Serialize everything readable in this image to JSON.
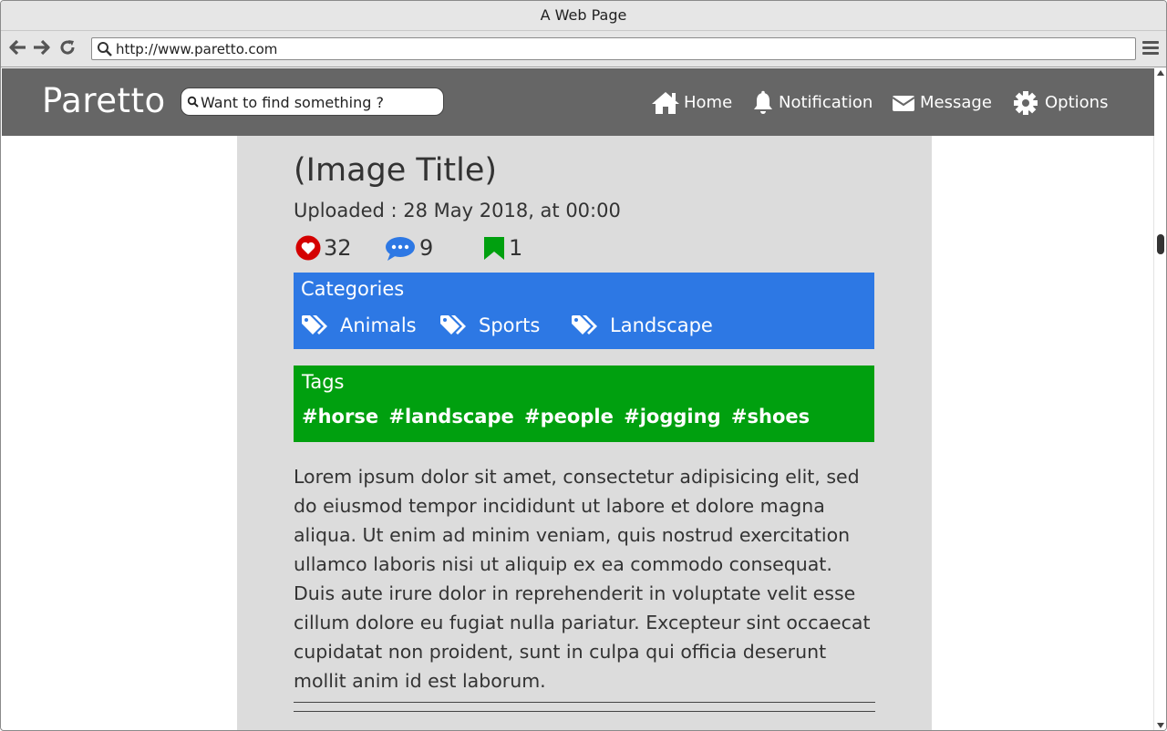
{
  "browser": {
    "window_title": "A Web Page",
    "url": "http://www.paretto.com"
  },
  "site": {
    "logo": "Paretto",
    "search_placeholder": "Want to find something ?",
    "menu": [
      {
        "label": "Home",
        "icon": "home-icon"
      },
      {
        "label": "Notification",
        "icon": "bell-icon"
      },
      {
        "label": "Message",
        "icon": "envelope-icon"
      },
      {
        "label": "Options",
        "icon": "gear-icon"
      }
    ]
  },
  "post": {
    "title": "(Image Title)",
    "uploaded": "Uploaded : 28 May 2018, at 00:00",
    "likes": "32",
    "comments": "9",
    "bookmarks": "1"
  },
  "categories": {
    "label": "Categories",
    "items": [
      "Animals",
      "Sports",
      "Landscape"
    ]
  },
  "tags": {
    "label": "Tags",
    "items": [
      "#horse",
      "#landscape",
      "#people",
      "#jogging",
      "#shoes"
    ]
  },
  "description": "Lorem ipsum dolor sit amet, consectetur adipisicing elit, sed do eiusmod tempor incididunt ut labore et dolore magna aliqua. Ut enim ad minim veniam, quis nostrud exercitation ullamco laboris nisi ut aliquip ex ea commodo consequat. Duis aute irure dolor in reprehenderit in voluptate velit esse cillum dolore eu fugiat nulla pariatur. Excepteur sint occaecat cupidatat non proident, sunt in culpa qui officia deserunt mollit anim id est laborum.",
  "colors": {
    "header_bg": "#666666",
    "content_bg": "#dcdcdc",
    "categories_bg": "#2d78e4",
    "tags_bg": "#00a00f",
    "like_icon": "#d40000",
    "comment_icon": "#2d78e4",
    "bookmark_icon": "#00a00f"
  }
}
